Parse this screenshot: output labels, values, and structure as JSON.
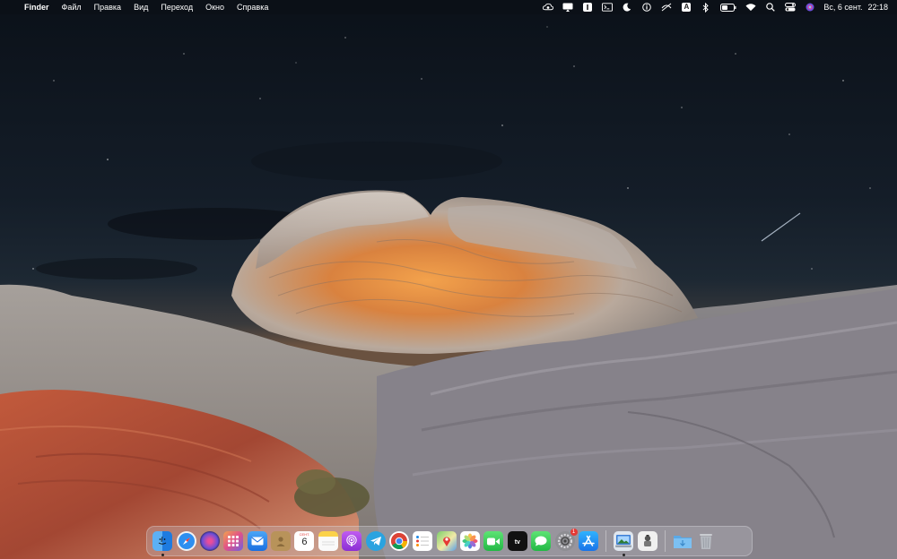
{
  "menubar": {
    "apple_glyph": "",
    "app_name": "Finder",
    "menus": [
      "Файл",
      "Правка",
      "Вид",
      "Переход",
      "Окно",
      "Справка"
    ],
    "status_icons": [
      "cloud-sync-icon",
      "screen-mirror-icon",
      "klokki-icon",
      "terminal-icon",
      "moon-icon",
      "info-icon",
      "slash-icon",
      "input-source-icon",
      "bluetooth-icon",
      "battery-icon",
      "wifi-icon",
      "spotlight-icon",
      "control-center-icon",
      "siri-icon"
    ],
    "input_source": "A",
    "date": "Вс, 6 сент.",
    "time": "22:18"
  },
  "dock": {
    "calendar_month": "СЕНТ.",
    "calendar_day": "6",
    "tv_label": "tv",
    "settings_badge": "1",
    "apps": [
      "finder",
      "safari",
      "siri",
      "launchpad",
      "mail",
      "contacts",
      "calendar",
      "notes",
      "podcasts",
      "telegram",
      "chrome",
      "reminders",
      "maps",
      "photos",
      "facetime",
      "tv",
      "messages",
      "system-preferences",
      "app-store",
      "preview",
      "automator",
      "downloads-folder",
      "trash"
    ]
  },
  "colors": {
    "sky_top": "#0b1119",
    "sky_mid": "#16212d",
    "horizon": "#5a4a3c",
    "rock_orange": "#e0873e",
    "rock_light": "#c8c2bc",
    "sand_red": "#b0523a"
  }
}
